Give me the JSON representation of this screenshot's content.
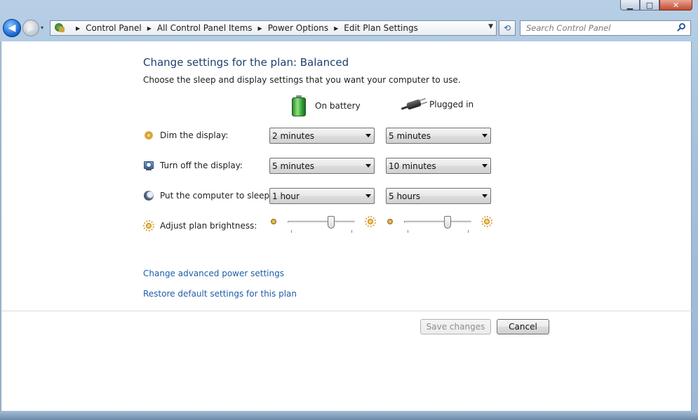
{
  "window": {
    "minimize_glyph": "▁",
    "maximize_glyph": "□",
    "close_glyph": "✕"
  },
  "navigation": {
    "back_glyph": "◀",
    "forward_glyph": "▶",
    "recent_glyph": "▾",
    "breadcrumbs": [
      "Control Panel",
      "All Control Panel Items",
      "Power Options",
      "Edit Plan Settings"
    ],
    "crumb_separator": "▶",
    "address_dropdown_glyph": "▼",
    "refresh_glyph": "⟲",
    "search_placeholder": "Search Control Panel"
  },
  "page": {
    "title": "Change settings for the plan: Balanced",
    "subtitle": "Choose the sleep and display settings that you want your computer to use.",
    "columns": {
      "battery": "On battery",
      "plugged": "Plugged in"
    },
    "rows": [
      {
        "label": "Dim the display:",
        "battery": "2 minutes",
        "plugged": "5 minutes"
      },
      {
        "label": "Turn off the display:",
        "battery": "5 minutes",
        "plugged": "10 minutes"
      },
      {
        "label": "Put the computer to sleep:",
        "battery": "1 hour",
        "plugged": "5 hours"
      }
    ],
    "brightness": {
      "label": "Adjust plan brightness:",
      "battery_level": 0.65,
      "plugged_level": 0.65
    },
    "links": {
      "advanced": "Change advanced power settings",
      "restore": "Restore default settings for this plan"
    },
    "buttons": {
      "save": "Save changes",
      "cancel": "Cancel"
    }
  }
}
